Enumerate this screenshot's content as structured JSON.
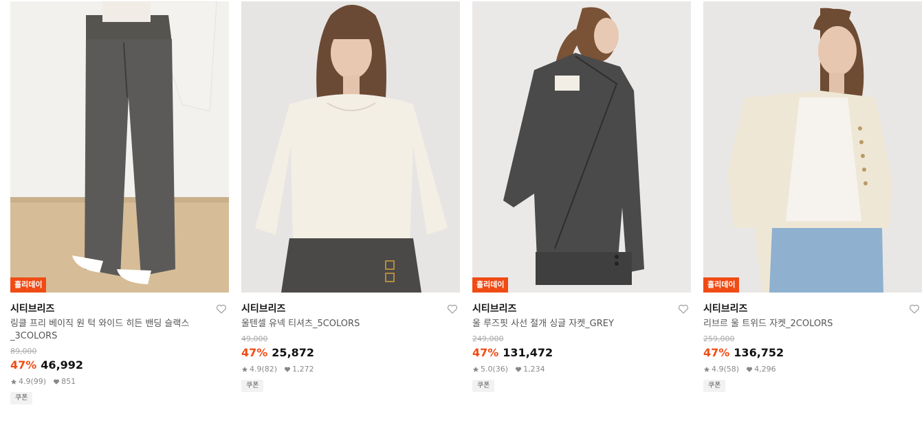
{
  "products": [
    {
      "badge": "홀리데이",
      "brand": "시티브리즈",
      "title": "링클 프리 베이직 원 턱 와이드 히든 밴딩 슬랙스_3COLORS",
      "original_price": "89,000",
      "discount": "47%",
      "price": "46,992",
      "rating": "4.9",
      "reviews": "(99)",
      "likes": "851",
      "coupon": "쿠폰",
      "image": "gray-wide-slacks-model",
      "colors": {
        "bg": "#f1efec",
        "garment": "#5b5a58",
        "accent": "#c9b08b"
      }
    },
    {
      "badge": "",
      "brand": "시티브리즈",
      "title": "울텐셀 유넥 티셔츠_5COLORS",
      "original_price": "49,000",
      "discount": "47%",
      "price": "25,872",
      "rating": "4.9",
      "reviews": "(82)",
      "likes": "1,272",
      "coupon": "쿠폰",
      "image": "ivory-u-neck-tee-model",
      "colors": {
        "bg": "#e6e4e2",
        "garment": "#f4efe5",
        "accent": "#4a4948"
      }
    },
    {
      "badge": "홀리데이",
      "brand": "시티브리즈",
      "title": "울 루즈핏 사선 절개 싱글 자켓_GREY",
      "original_price": "249,000",
      "discount": "47%",
      "price": "131,472",
      "rating": "5.0",
      "reviews": "(36)",
      "likes": "1,234",
      "coupon": "쿠폰",
      "image": "grey-single-jacket-back-model",
      "colors": {
        "bg": "#ebe9e7",
        "garment": "#4a4a4a",
        "accent": "#e7dccf"
      }
    },
    {
      "badge": "홀리데이",
      "brand": "시티브리즈",
      "title": "리브르 울 트위드 자켓_2COLORS",
      "original_price": "259,000",
      "discount": "47%",
      "price": "136,752",
      "rating": "4.9",
      "reviews": "(58)",
      "likes": "4,296",
      "coupon": "쿠폰",
      "image": "ivory-tweed-jacket-model",
      "colors": {
        "bg": "#e7e6e4",
        "garment": "#efe7d6",
        "accent": "#8fb1cf"
      }
    }
  ],
  "theme": {
    "accent": "#f04b14",
    "muted": "#888888",
    "strike": "#aaaaaa"
  },
  "icons": {
    "like": "heart-outline-icon",
    "rating": "star-icon",
    "likes_count": "heart-filled-icon"
  }
}
